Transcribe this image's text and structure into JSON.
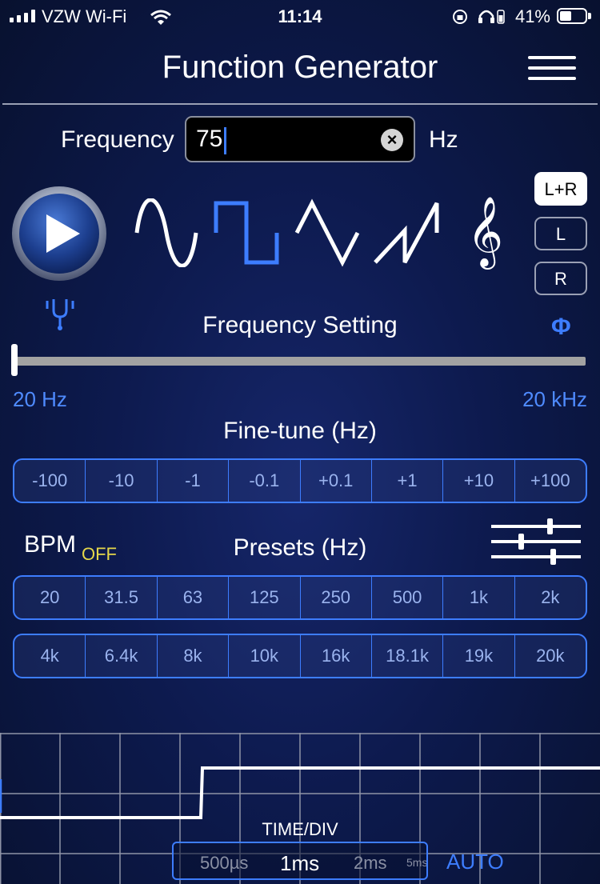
{
  "status_bar": {
    "carrier": "VZW Wi-Fi",
    "time": "11:14",
    "battery": "41%"
  },
  "header": {
    "title": "Function Generator",
    "menu_icon": "hamburger-menu-icon"
  },
  "frequency": {
    "label": "Frequency",
    "value": "75",
    "unit": "Hz",
    "clear_icon": "clear-x-icon"
  },
  "waveforms": {
    "items": [
      "sine-wave-icon",
      "square-wave-icon",
      "triangle-wave-icon",
      "sawtooth-wave-icon",
      "treble-clef-icon"
    ],
    "selected": "square-wave-icon",
    "clef_glyph": "𝄞"
  },
  "channels": {
    "options": [
      "L+R",
      "L",
      "R"
    ],
    "selected": "L+R"
  },
  "frequency_setting": {
    "title": "Frequency Setting",
    "phase_symbol": "Φ",
    "min_label": "20 Hz",
    "max_label": "20 kHz",
    "slider_fraction": 0.003
  },
  "fine_tune": {
    "title": "Fine-tune (Hz)",
    "buttons": [
      "-100",
      "-10",
      "-1",
      "-0.1",
      "+0.1",
      "+1",
      "+10",
      "+100"
    ]
  },
  "presets": {
    "bpm_label": "BPM",
    "bpm_state": "OFF",
    "title": "Presets (Hz)",
    "row1": [
      "20",
      "31.5",
      "63",
      "125",
      "250",
      "500",
      "1k",
      "2k"
    ],
    "row2": [
      "4k",
      "6.4k",
      "8k",
      "10k",
      "16k",
      "18.1k",
      "19k",
      "20k"
    ]
  },
  "scope": {
    "time_div_label": "TIME/DIV",
    "time_div_options": [
      "500µs",
      "1ms",
      "2ms",
      "5ms"
    ],
    "selected": "1ms",
    "auto_label": "AUTO"
  },
  "colors": {
    "accent": "#3d7dff",
    "bpm_off": "#e5d74a",
    "background": "#0d1a4e"
  }
}
